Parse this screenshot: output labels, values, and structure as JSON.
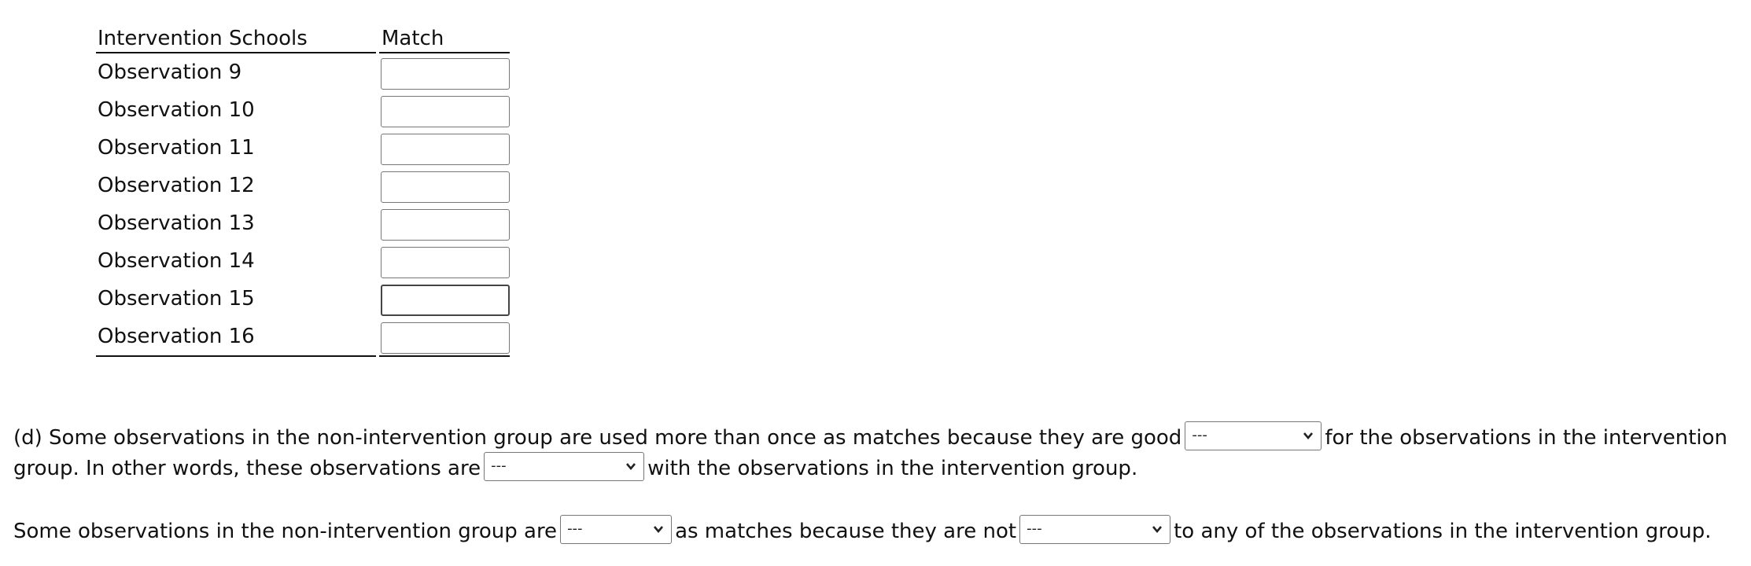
{
  "table": {
    "headers": [
      "Intervention Schools",
      "Match"
    ],
    "rows": [
      {
        "label": "Observation 9",
        "value": ""
      },
      {
        "label": "Observation 10",
        "value": ""
      },
      {
        "label": "Observation 11",
        "value": ""
      },
      {
        "label": "Observation 12",
        "value": ""
      },
      {
        "label": "Observation 13",
        "value": ""
      },
      {
        "label": "Observation 14",
        "value": ""
      },
      {
        "label": "Observation 15",
        "value": ""
      },
      {
        "label": "Observation 16",
        "value": ""
      }
    ]
  },
  "part_d": {
    "line1_a": "(d) Some observations in the non-intervention group are used more than once as matches because they are good",
    "line1_b": "for the observations in the intervention",
    "line2_a": "group. In other words, these observations are",
    "line2_b": "with the observations in the intervention group.",
    "line3_a": "Some observations in the non-intervention group are",
    "line3_b": "as matches because they are not",
    "line3_c": "to any of the observations in the intervention group.",
    "selects": [
      {
        "selected": "---"
      },
      {
        "selected": "---"
      },
      {
        "selected": "---"
      },
      {
        "selected": "---"
      }
    ]
  }
}
